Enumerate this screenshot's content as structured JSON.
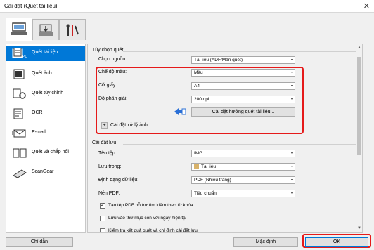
{
  "window": {
    "title": "Cài đặt (Quét tài liệu)"
  },
  "tabs": [
    {
      "icon": "scan-computer-icon",
      "active": true
    },
    {
      "icon": "scan-to-folder-icon",
      "active": false
    },
    {
      "icon": "tools-icon",
      "active": false
    }
  ],
  "sidebar": {
    "items": [
      {
        "label": "Quét tài liệu",
        "icon": "document-scan-icon",
        "selected": true
      },
      {
        "label": "Quét ảnh",
        "icon": "photo-scan-icon",
        "selected": false
      },
      {
        "label": "Quét tùy chỉnh",
        "icon": "custom-scan-icon",
        "selected": false
      },
      {
        "label": "OCR",
        "icon": "ocr-icon",
        "selected": false
      },
      {
        "label": "E-mail",
        "icon": "email-icon",
        "selected": false
      },
      {
        "label": "Quét và chắp nối",
        "icon": "stitch-icon",
        "selected": false
      },
      {
        "label": "ScanGear",
        "icon": "scangear-icon",
        "selected": false
      }
    ]
  },
  "scan_options": {
    "heading": "Tùy chọn quét",
    "source_label": "Chọn nguồn:",
    "source_value": "Tài liệu (ADF/Màn quét)",
    "color_mode_label": "Chế độ màu:",
    "color_mode_value": "Màu",
    "paper_size_label": "Cỡ giấy:",
    "paper_size_value": "A4",
    "resolution_label": "Độ phân giải:",
    "resolution_value": "200 dpi",
    "orientation_button": "Cài đặt hướng quét tài liệu...",
    "image_processing_label": "Cài đặt xử lý ảnh",
    "expand_symbol": "+"
  },
  "save_settings": {
    "heading": "Cài đặt lưu",
    "filename_label": "Tên tệp:",
    "filename_value": "IMG",
    "save_in_label": "Lưu trong:",
    "save_in_value": "Tài liệu",
    "format_label": "Định dạng dữ liệu:",
    "format_value": "PDF (Nhiều trang)",
    "pdf_compression_label": "Nén PDF:",
    "pdf_compression_value": "Tiêu chuẩn",
    "checkbox_pdf_search": "Tạo tệp PDF hỗ trợ tìm kiếm theo từ khóa",
    "checkbox_pdf_search_checked": true,
    "checkbox_subfolder": "Lưu vào thư mục con với ngày hiện tại",
    "checkbox_subfolder_checked": false,
    "checkbox_check_results": "Kiểm tra kết quả quét và chỉ định cài đặt lưu",
    "checkbox_check_results_checked": false
  },
  "footer": {
    "guide_label": "Chỉ dẫn",
    "default_label": "Mặc định",
    "ok_label": "OK"
  },
  "colors": {
    "highlight": "#e51a1a",
    "selection": "#0078d7"
  }
}
